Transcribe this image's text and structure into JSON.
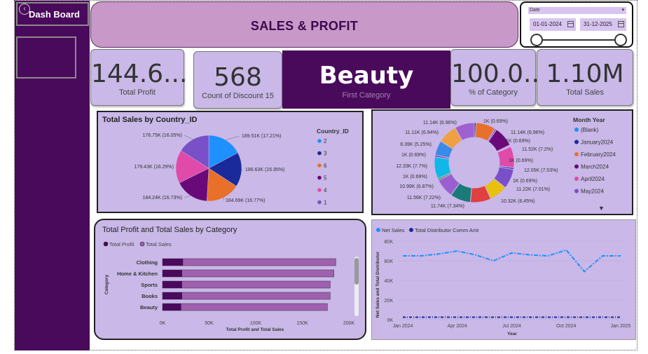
{
  "sidebar": {
    "dashboard_label": "Dash Board"
  },
  "header": {
    "title": "SALES & PROFIT"
  },
  "date_filter": {
    "label": "Date",
    "start": "01-01-2024",
    "end": "31-12-2025"
  },
  "kpis": {
    "total_profit": {
      "value": "144.6...",
      "label": "Total Profit"
    },
    "count_discount": {
      "value": "568",
      "label": "Count of Discount 15"
    },
    "first_category": {
      "value": "Beauty",
      "label": "First Category"
    },
    "pct_category": {
      "value": "100.0...",
      "label": "% of Category"
    },
    "total_sales": {
      "value": "1.10M",
      "label": "Total Sales"
    }
  },
  "colors": {
    "sidebar": "#4a0a5c",
    "panel": "#c9b8e8",
    "title": "#c798c8"
  },
  "chart_data": [
    {
      "type": "pie",
      "title": "Total Sales by Country_ID",
      "legend_title": "Country_ID",
      "legend": [
        "2",
        "3",
        "6",
        "5",
        "4",
        "1"
      ],
      "slices": [
        {
          "label": "189.51K (17.21%)",
          "value": 189.51,
          "color": "#1e90ff"
        },
        {
          "label": "186.63K (16.95%)",
          "value": 186.63,
          "color": "#1a2a9a"
        },
        {
          "label": "184.69K (16.77%)",
          "value": 184.69,
          "color": "#e8702a"
        },
        {
          "label": "184.24K (16.73%)",
          "value": 184.24,
          "color": "#6a0a7a"
        },
        {
          "label": "179.43K (16.29%)",
          "value": 179.43,
          "color": "#e04aa8"
        },
        {
          "label": "176.75K (16.05%)",
          "value": 176.75,
          "color": "#7a50c8"
        }
      ],
      "legend_colors": [
        "#1e90ff",
        "#1a2a9a",
        "#e8702a",
        "#6a0a7a",
        "#e04aa8",
        "#7a50c8"
      ]
    },
    {
      "type": "pie",
      "legend_title": "Month Year",
      "legend": [
        "(Blank)",
        "January2024",
        "February2024",
        "March2024",
        "April2024",
        "May2024"
      ],
      "legend_colors": [
        "#1e90ff",
        "#1a2a9a",
        "#e8702a",
        "#6a0a7a",
        "#e04aa8",
        "#7a50c8"
      ],
      "right_labels": [
        "1K (0.69%)",
        "11.14K (6.96%)",
        "1K (0.69%)",
        "11.52K (7.2%)",
        "1K (0.69%)",
        "12.05K (7.53%)",
        "1K (0.69%)",
        "11.22K (7.01%)",
        "10.32K (6.45%)"
      ],
      "left_labels": [
        "11.14K (6.96%)",
        "11.11K (6.94%)",
        "8.39K (5.25%)",
        "1K (0.69%)",
        "12.33K (7.7%)",
        "1K (0.69%)",
        "10.99K (6.87%)",
        "11.56K (7.22%)",
        "11.74K (7.34%)"
      ],
      "values": [
        1,
        11.14,
        1,
        11.52,
        1,
        12.05,
        1,
        11.22,
        10.32,
        11.74,
        11.56,
        10.99,
        1,
        12.33,
        1,
        8.39,
        11.11,
        11.14
      ],
      "colors": [
        "#1a2a9a",
        "#e8702a",
        "#8a4ad0",
        "#6a0a7a",
        "#c8a0e8",
        "#e04aa8",
        "#2a2aa0",
        "#7a50c8",
        "#e8c010",
        "#e04040",
        "#1a7a7a",
        "#9a60d0",
        "#2a9a40",
        "#10b8e8",
        "#5a3aa0",
        "#3a8ae8",
        "#f0a040",
        "#a060d0"
      ]
    },
    {
      "type": "bar",
      "title": "Total Profit and Total Sales by Category",
      "legend": [
        "Total Profit",
        "Total Sales"
      ],
      "legend_colors": [
        "#4a0a5c",
        "#a060b0"
      ],
      "categories": [
        "Clothing",
        "Home & Kitchen",
        "Sports",
        "Books",
        "Beauty"
      ],
      "series": [
        {
          "name": "Total Profit",
          "values": [
            22000,
            21000,
            21000,
            21000,
            20000
          ]
        },
        {
          "name": "Total Sales",
          "values": [
            186000,
            184000,
            180000,
            180000,
            177000
          ]
        }
      ],
      "xticks": [
        "0K",
        "50K",
        "100K",
        "150K",
        "200K"
      ],
      "xlim": [
        0,
        200000
      ],
      "xlabel": "Total Profit and Total Sales",
      "ylabel": "Category"
    },
    {
      "type": "line",
      "legend": [
        "Net Sales",
        "Total Distributor Comm Amt"
      ],
      "legend_colors": [
        "#1e90ff",
        "#1a2a9a"
      ],
      "x": [
        0,
        1,
        2,
        3,
        4,
        5,
        6,
        7,
        8,
        9,
        10,
        11,
        12
      ],
      "series": [
        {
          "name": "Net Sales",
          "values": [
            65000,
            65000,
            67000,
            70000,
            66000,
            60000,
            68000,
            66000,
            65000,
            71000,
            49000,
            65000,
            65000
          ]
        },
        {
          "name": "Total Distributor Comm Amt",
          "values": [
            2500,
            2500,
            2500,
            2500,
            2500,
            2500,
            2500,
            2500,
            2500,
            2500,
            2500,
            2500,
            2500
          ]
        }
      ],
      "xticks": [
        "Jan 2024",
        "Apr 2024",
        "Jul 2024",
        "Oct 2024",
        "Jan 2025"
      ],
      "yticks": [
        "0K",
        "20K",
        "40K",
        "60K",
        "80K"
      ],
      "ylim": [
        0,
        80000
      ],
      "xlabel": "Year",
      "ylabel": "Net Sales and Total Distributor"
    }
  ]
}
